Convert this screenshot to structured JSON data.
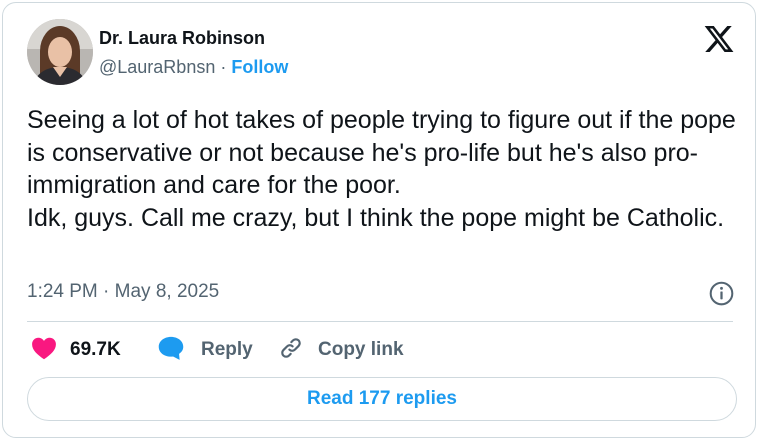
{
  "author": {
    "display_name": "Dr. Laura Robinson",
    "handle": "@LauraRbnsn",
    "separator": "·",
    "follow_label": "Follow"
  },
  "tweet": {
    "paragraphs": [
      "Seeing a lot of hot takes of people trying to figure out if the pope is conservative or not because he's pro-life but he's also pro-immigration and care for the poor.",
      "Idk, guys. Call me crazy, but I think the pope might be Catholic."
    ],
    "timestamp": "1:24 PM · May 8, 2025"
  },
  "actions": {
    "like_count": "69.7K",
    "reply_label": "Reply",
    "copy_label": "Copy link"
  },
  "read_replies_label": "Read 177 replies",
  "icons": {
    "brand": "x-logo-icon",
    "info": "info-icon",
    "like": "heart-icon",
    "reply": "speech-bubble-icon",
    "copy": "link-icon"
  },
  "colors": {
    "accent": "#1d9bf0",
    "like": "#f91880",
    "text": "#0f1419",
    "muted": "#536471",
    "border": "#cfd9de"
  }
}
